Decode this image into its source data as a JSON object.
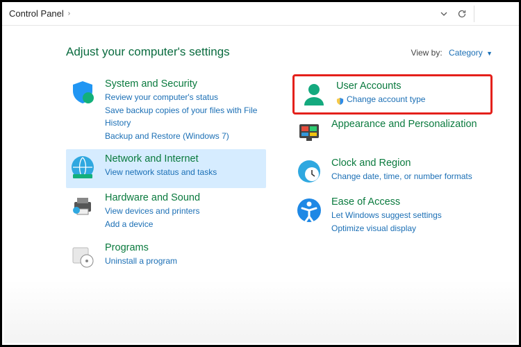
{
  "breadcrumb": {
    "root": "Control Panel"
  },
  "header": {
    "title": "Adjust your computer's settings",
    "viewby_label": "View by:",
    "viewby_value": "Category"
  },
  "left": [
    {
      "icon": "shield",
      "title": "System and Security",
      "links": [
        "Review your computer's status",
        "Save backup copies of your files with File History",
        "Backup and Restore (Windows 7)"
      ]
    },
    {
      "icon": "globe",
      "title": "Network and Internet",
      "links": [
        "View network status and tasks"
      ],
      "selected": true
    },
    {
      "icon": "printer",
      "title": "Hardware and Sound",
      "links": [
        "View devices and printers",
        "Add a device"
      ]
    },
    {
      "icon": "programs",
      "title": "Programs",
      "links": [
        "Uninstall a program"
      ]
    }
  ],
  "right": [
    {
      "icon": "user",
      "title": "User Accounts",
      "links": [
        "Change account type"
      ],
      "shield_on_first": true,
      "highlighted": true
    },
    {
      "icon": "personalize",
      "title": "Appearance and Personalization",
      "links": []
    },
    {
      "icon": "clock",
      "title": "Clock and Region",
      "links": [
        "Change date, time, or number formats"
      ]
    },
    {
      "icon": "ease",
      "title": "Ease of Access",
      "links": [
        "Let Windows suggest settings",
        "Optimize visual display"
      ]
    }
  ]
}
